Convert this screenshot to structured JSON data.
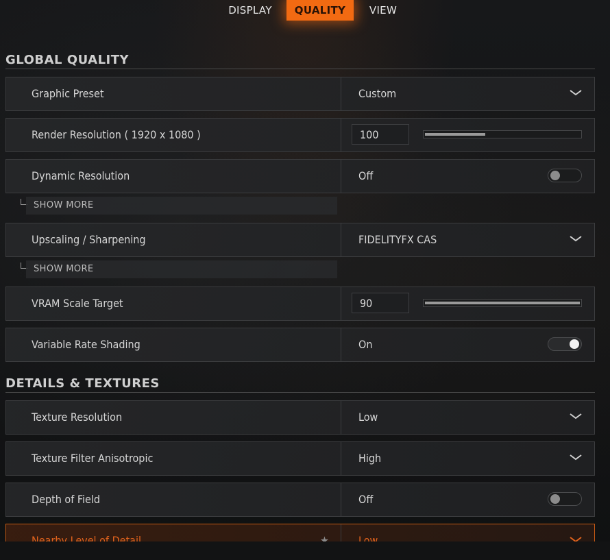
{
  "tabs": [
    {
      "label": "DISPLAY",
      "active": false
    },
    {
      "label": "QUALITY",
      "active": true
    },
    {
      "label": "VIEW",
      "active": false
    }
  ],
  "accent_color": "#f26a12",
  "sections": {
    "global": {
      "title": "GLOBAL QUALITY"
    },
    "details": {
      "title": "DETAILS & TEXTURES"
    }
  },
  "settings": {
    "graphic_preset": {
      "label": "Graphic Preset",
      "value": "Custom",
      "control": "dropdown"
    },
    "render_resolution": {
      "label": "Render Resolution ( 1920 x 1080 )",
      "value": "100",
      "control": "slider",
      "fill_fraction": 0.39
    },
    "dynamic_resolution": {
      "label": "Dynamic Resolution",
      "value": "Off",
      "control": "toggle",
      "state": false
    },
    "upscaling": {
      "label": "Upscaling / Sharpening",
      "value": "FIDELITYFX CAS",
      "control": "dropdown"
    },
    "vram_scale": {
      "label": "VRAM Scale Target",
      "value": "90",
      "control": "slider",
      "fill_fraction": 1.0
    },
    "variable_rate_shading": {
      "label": "Variable Rate Shading",
      "value": "On",
      "control": "toggle",
      "state": true
    },
    "texture_resolution": {
      "label": "Texture Resolution",
      "value": "Low",
      "control": "dropdown"
    },
    "texture_filter": {
      "label": "Texture Filter Anisotropic",
      "value": "High",
      "control": "dropdown"
    },
    "depth_of_field": {
      "label": "Depth of Field",
      "value": "Off",
      "control": "toggle",
      "state": false
    },
    "nearby_lod": {
      "label": "Nearby Level of Detail",
      "value": "Low",
      "control": "dropdown",
      "highlighted": true
    }
  },
  "show_more_label": "SHOW MORE",
  "icons": {
    "dropdown": "chevron-down-icon",
    "favorite": "star-icon",
    "submenu": "submenu-elbow-icon"
  }
}
